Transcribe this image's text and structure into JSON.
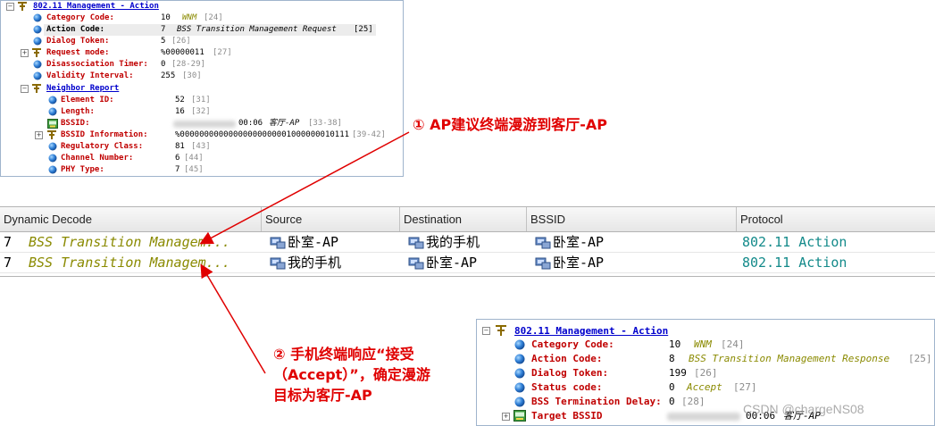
{
  "top_decode": {
    "header": "802.11 Management - Action",
    "category": {
      "label": "Category Code:",
      "value": "10",
      "meaning": "WNM",
      "offset": "[24]"
    },
    "action": {
      "label": "Action Code:",
      "value": "7",
      "meaning": "BSS Transition Management Request",
      "offset": "[25]"
    },
    "dialog": {
      "label": "Dialog Token:",
      "value": "5",
      "offset": "[26]"
    },
    "request_mode": {
      "label": "Request mode:",
      "value": "%00000011",
      "offset": "[27]"
    },
    "disassoc": {
      "label": "Disassociation Timer:",
      "value": "0",
      "offset": "[28-29]"
    },
    "validity": {
      "label": "Validity Interval:",
      "value": "255",
      "offset": "[30]"
    },
    "neighbor": {
      "header": "Neighbor Report",
      "element_id": {
        "label": "Element ID:",
        "value": "52",
        "offset": "[31]"
      },
      "length": {
        "label": "Length:",
        "value": "16",
        "offset": "[32]"
      },
      "bssid": {
        "label": "BSSID:",
        "value": "00:06",
        "meaning": "客厅-AP",
        "offset": "[33-38]"
      },
      "bssid_info": {
        "label": "BSSID Information:",
        "value": "%00000000000000000000001000000010111",
        "offset": "[39-42]"
      },
      "regulatory": {
        "label": "Regulatory Class:",
        "value": "81",
        "offset": "[43]"
      },
      "channel": {
        "label": "Channel Number:",
        "value": "6",
        "offset": "[44]"
      },
      "phy": {
        "label": "PHY Type:",
        "value": "7",
        "offset": "[45]"
      }
    }
  },
  "packet_list": {
    "columns": [
      "Dynamic Decode",
      "Source",
      "Destination",
      "BSSID",
      "Protocol"
    ],
    "rows": [
      {
        "num": "7",
        "decode": "BSS Transition Managem...",
        "source": "卧室-AP",
        "destination": "我的手机",
        "bssid": "卧室-AP",
        "protocol": "802.11 Action"
      },
      {
        "num": "7",
        "decode": "BSS Transition Managem...",
        "source": "我的手机",
        "destination": "卧室-AP",
        "bssid": "卧室-AP",
        "protocol": "802.11 Action"
      }
    ]
  },
  "bottom_decode": {
    "header": "802.11 Management - Action",
    "category": {
      "label": "Category Code:",
      "value": "10",
      "meaning": "WNM",
      "offset": "[24]"
    },
    "action": {
      "label": "Action Code:",
      "value": "8",
      "meaning": "BSS Transition Management Response",
      "offset": "[25]"
    },
    "dialog": {
      "label": "Dialog Token:",
      "value": "199",
      "offset": "[26]"
    },
    "status": {
      "label": "Status code:",
      "value": "0",
      "meaning": "Accept",
      "offset": "[27]"
    },
    "termination": {
      "label": "BSS Termination Delay:",
      "value": "0",
      "offset": "[28]"
    },
    "target": {
      "label": "Target BSSID",
      "value": "00:06",
      "meaning": "客厅-AP"
    }
  },
  "annotations": {
    "first": "① AP建议终端漫游到客厅-AP",
    "second_line1": "② 手机终端响应“接受",
    "second_line2": "（Accept）”，确定漫游",
    "second_line3": "目标为客厅-AP"
  },
  "watermark": "CSDN @chargeNS08",
  "colors": {
    "annotation_red": "#e00000",
    "field_red": "#c00000",
    "protocol_teal": "#138a8a",
    "decode_olive": "#8a8a00"
  }
}
